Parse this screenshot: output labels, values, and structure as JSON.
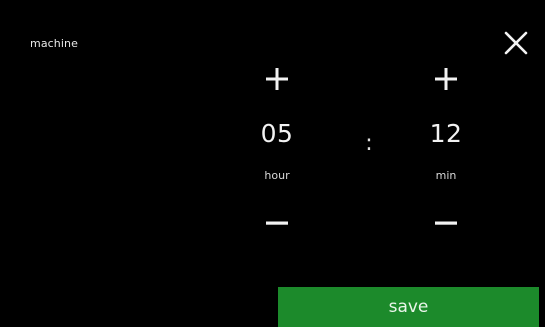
{
  "header": {
    "title": "machine",
    "close_icon": "close-icon"
  },
  "time": {
    "hours": {
      "value": "05",
      "unit": "hour",
      "increment_icon": "plus-icon",
      "decrement_icon": "minus-icon"
    },
    "separator": ":",
    "minutes": {
      "value": "12",
      "unit": "min",
      "increment_icon": "plus-icon",
      "decrement_icon": "minus-icon"
    }
  },
  "actions": {
    "save_label": "save"
  },
  "colors": {
    "background": "#000000",
    "text": "#f2f2f2",
    "save_button": "#1c8a2b"
  }
}
